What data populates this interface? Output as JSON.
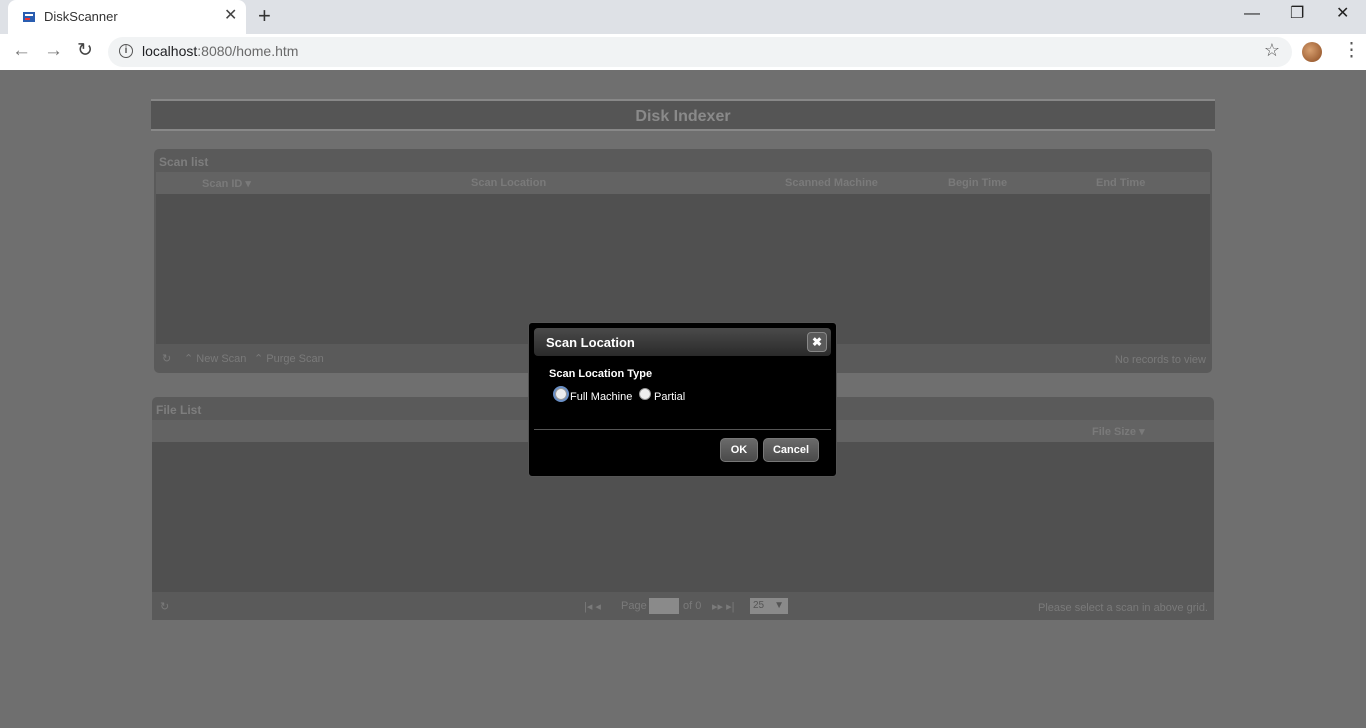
{
  "browser": {
    "tab_title": "DiskScanner",
    "tab_close": "✕",
    "new_tab": "+",
    "url_host": "localhost",
    "url_path": ":8080/home.htm",
    "window_controls": [
      "—",
      "❐",
      "✕"
    ],
    "nav": {
      "back": "←",
      "forward": "→",
      "reload": "↻"
    },
    "star": "☆",
    "menu": "⋮"
  },
  "page": {
    "header_title": "Disk Indexer",
    "scan_list": {
      "title": "Scan list",
      "columns": [
        "Scan ID ▾",
        "Scan Location",
        "Scanned Machine",
        "Begin Time",
        "End Time"
      ],
      "footer_refresh": "↻",
      "new_scan": "⌃ New Scan",
      "purge_scan": "⌃ Purge Scan",
      "status": "No records to view"
    },
    "file_list": {
      "title": "File List",
      "columns": [
        "File Size ▾"
      ],
      "footer_refresh": "↻",
      "pager_first_prev": "|◂ ◂",
      "page_label": "Page",
      "page_of": "of 0",
      "pager_next_last": "▸▸ ▸|",
      "page_size": "25",
      "page_size_caret": "▼",
      "status": "Please select a scan in above grid."
    }
  },
  "dialog": {
    "title": "Scan Location",
    "close": "✖",
    "field_label": "Scan Location Type",
    "options": [
      {
        "label": "Full Machine",
        "selected": true
      },
      {
        "label": "Partial",
        "selected": false
      }
    ],
    "ok_label": "OK",
    "cancel_label": "Cancel"
  }
}
